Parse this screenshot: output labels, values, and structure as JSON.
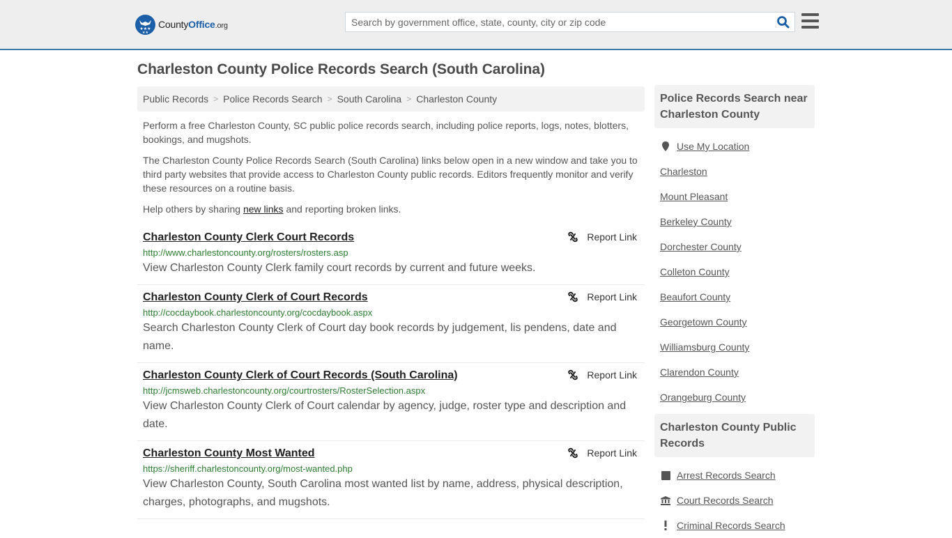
{
  "header": {
    "logo": {
      "county": "County",
      "office": "Office",
      "org": ".org"
    },
    "search_placeholder": "Search by government office, state, county, city or zip code",
    "colors": {
      "brand_blue": "#1a5fa8",
      "header_border": "#3a78a8",
      "url_green": "#2e7d32"
    }
  },
  "page": {
    "title": "Charleston County Police Records Search (South Carolina)",
    "breadcrumb": [
      {
        "label": "Public Records"
      },
      {
        "label": "Police Records Search"
      },
      {
        "label": "South Carolina"
      },
      {
        "label": "Charleston County"
      }
    ],
    "intro": {
      "p1": "Perform a free Charleston County, SC public police records search, including police reports, logs, notes, blotters, bookings, and mugshots.",
      "p2": "The Charleston County Police Records Search (South Carolina) links below open in a new window and take you to third party websites that provide access to Charleston County public records. Editors frequently monitor and verify these resources on a routine basis.",
      "p3_before": "Help others by sharing ",
      "p3_link": "new links",
      "p3_after": " and reporting broken links."
    }
  },
  "results": [
    {
      "title": "Charleston County Clerk Court Records",
      "url": "http://www.charlestoncounty.org/rosters/rosters.asp",
      "description": "View Charleston County Clerk family court records by current and future weeks.",
      "report_label": "Report Link"
    },
    {
      "title": "Charleston County Clerk of Court Records",
      "url": "http://cocdaybook.charlestoncounty.org/cocdaybook.aspx",
      "description": "Search Charleston County Clerk of Court day book records by judgement, lis pendens, date and name.",
      "report_label": "Report Link"
    },
    {
      "title": "Charleston County Clerk of Court Records (South Carolina)",
      "url": "http://jcmsweb.charlestoncounty.org/courtrosters/RosterSelection.aspx",
      "description": "View Charleston County Clerk of Court calendar by agency, judge, roster type and description and date.",
      "report_label": "Report Link"
    },
    {
      "title": "Charleston County Most Wanted",
      "url": "https://sheriff.charlestoncounty.org/most-wanted.php",
      "description": "View Charleston County, South Carolina most wanted list by name, address, physical description, charges, photographs, and mugshots.",
      "report_label": "Report Link"
    }
  ],
  "sidebar": {
    "nearby": {
      "heading": "Police Records Search near Charleston County",
      "use_location": "Use My Location",
      "items": [
        "Charleston",
        "Mount Pleasant",
        "Berkeley County",
        "Dorchester County",
        "Colleton County",
        "Beaufort County",
        "Georgetown County",
        "Williamsburg County",
        "Clarendon County",
        "Orangeburg County"
      ]
    },
    "public_records": {
      "heading": "Charleston County Public Records",
      "items": [
        {
          "label": "Arrest Records Search",
          "icon": "square-icon"
        },
        {
          "label": "Court Records Search",
          "icon": "courthouse-icon"
        },
        {
          "label": "Criminal Records Search",
          "icon": "exclamation-icon"
        }
      ]
    }
  }
}
